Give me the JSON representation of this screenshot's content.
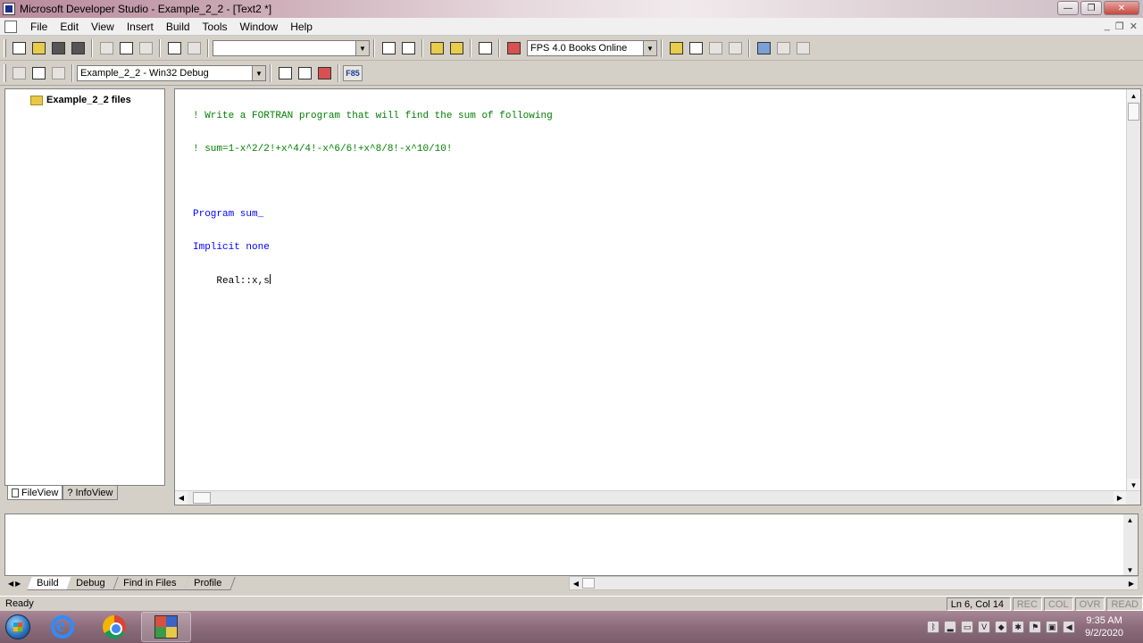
{
  "window": {
    "title": "Microsoft Developer Studio - Example_2_2 - [Text2 *]",
    "buttons": {
      "minimize": "—",
      "maximize": "❐",
      "close": "✕"
    }
  },
  "menu": {
    "items": [
      "File",
      "Edit",
      "View",
      "Insert",
      "Build",
      "Tools",
      "Window",
      "Help"
    ],
    "mdi": {
      "minimize": "_",
      "restore": "❐",
      "close": "✕"
    }
  },
  "toolbar": {
    "find_combo_value": "",
    "books_combo_value": "FPS 4.0 Books Online",
    "config_combo_value": "Example_2_2 - Win32 Debug",
    "f85_label": "F85"
  },
  "workspace": {
    "tree_root": "Example_2_2 files",
    "tabs": [
      "FileView",
      "InfoView"
    ]
  },
  "editor": {
    "lines": [
      {
        "type": "comment",
        "text": "! Write a FORTRAN program that will find the sum of following"
      },
      {
        "type": "comment",
        "text": "! sum=1-x^2/2!+x^4/4!-x^6/6!+x^8/8!-x^10/10!"
      },
      {
        "type": "blank",
        "text": ""
      },
      {
        "type": "keyword",
        "text": "Program sum_"
      },
      {
        "type": "keyword",
        "text": "Implicit none"
      },
      {
        "type": "text",
        "text": "    Real::x,s"
      }
    ]
  },
  "output": {
    "tabs": [
      "Build",
      "Debug",
      "Find in Files",
      "Profile"
    ]
  },
  "status": {
    "text": "Ready",
    "position": "Ln 6, Col 14",
    "indicators": [
      "REC",
      "COL",
      "OVR",
      "READ"
    ]
  },
  "taskbar": {
    "clock_time": "9:35 AM",
    "clock_date": "9/2/2020",
    "tray_icons": [
      "bluetooth-icon",
      "signal-icon",
      "monitor-icon",
      "v-icon",
      "shield-icon",
      "network-icon",
      "flag-icon",
      "display-icon",
      "volume-icon"
    ]
  },
  "colors": {
    "comment": "#008000",
    "keyword": "#0000ff",
    "title_bar": "#c9a7b3",
    "chrome": "#d4d0c8"
  }
}
